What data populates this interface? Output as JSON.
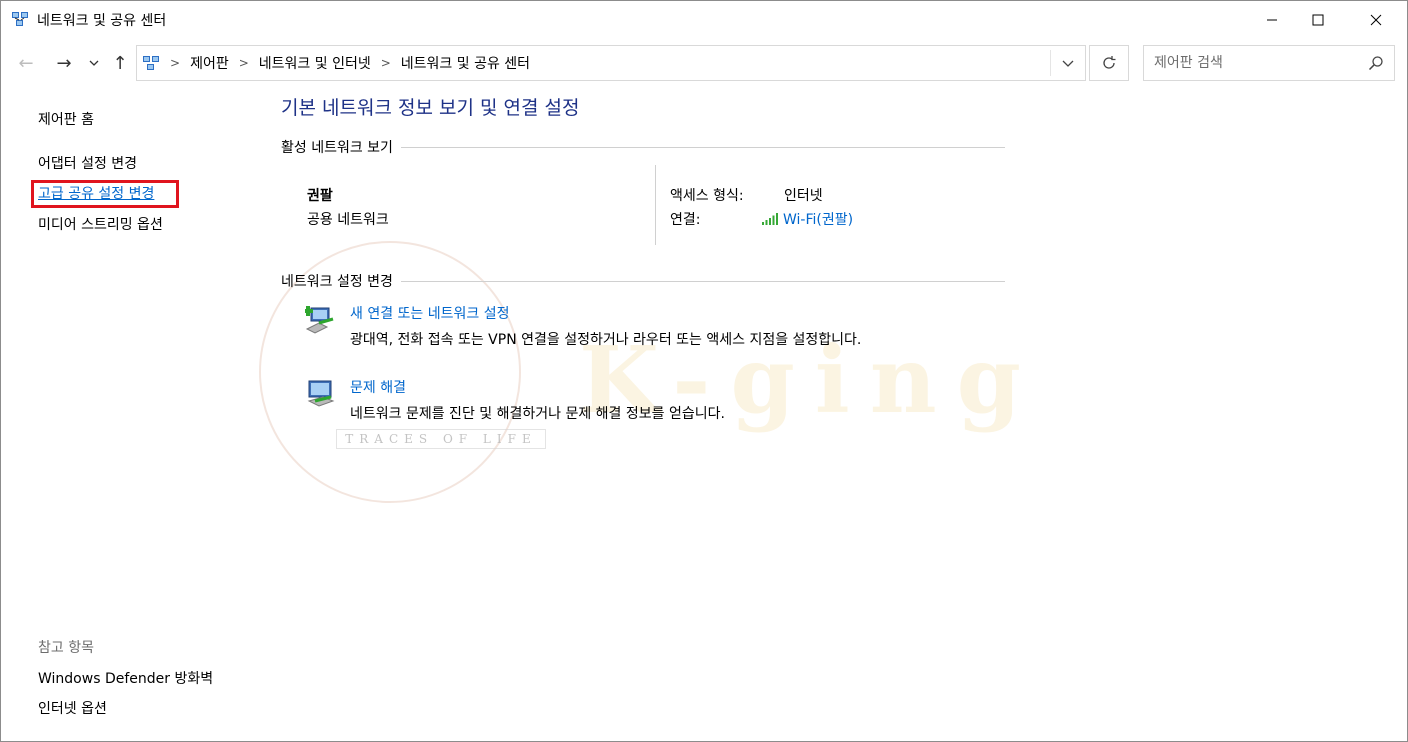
{
  "window": {
    "title": "네트워크 및 공유 센터",
    "icon": "network-icon"
  },
  "address_bar": {
    "breadcrumbs": [
      "제어판",
      "네트워크 및 인터넷",
      "네트워크 및 공유 센터"
    ],
    "search_placeholder": "제어판 검색"
  },
  "left_pane": {
    "home": "제어판 홈",
    "items": [
      "어댑터 설정 변경",
      "고급 공유 설정 변경",
      "미디어 스트리밍 옵션"
    ],
    "highlighted_index": 1,
    "see_also_header": "참고 항목",
    "see_also": [
      "Windows Defender 방화벽",
      "인터넷 옵션"
    ]
  },
  "main": {
    "title": "기본 네트워크 정보 보기 및 연결 설정",
    "active_section": "활성 네트워크 보기",
    "network_name": "권팔",
    "network_type": "공용 네트워크",
    "access_label": "액세스 형식:",
    "access_value": "인터넷",
    "connection_label": "연결:",
    "connection_value": "Wi-Fi(권팔)",
    "change_section": "네트워크 설정 변경",
    "tasks": [
      {
        "link": "새 연결 또는 네트워크 설정",
        "desc": "광대역, 전화 접속 또는 VPN 연결을 설정하거나 라우터 또는 액세스 지점을 설정합니다."
      },
      {
        "link": "문제 해결",
        "desc": "네트워크 문제를 진단 및 해결하거나 문제 해결 정보를 얻습니다."
      }
    ]
  },
  "watermark": {
    "brand": "K-ging",
    "tagline": "TRACES OF LIFE"
  },
  "colors": {
    "link": "#0066cc",
    "title": "#1e3287",
    "highlight": "#e0141e"
  }
}
